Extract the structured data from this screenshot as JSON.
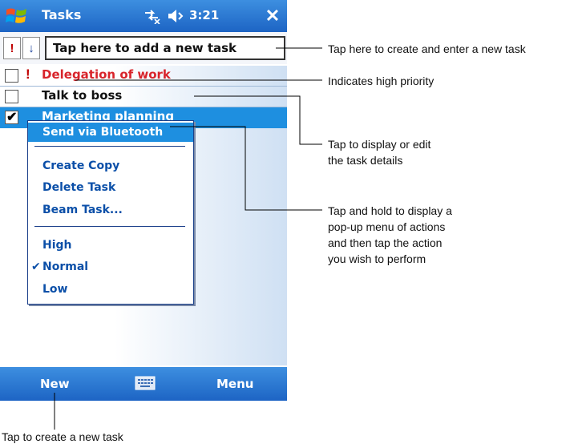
{
  "titlebar": {
    "app_title": "Tasks",
    "clock": "3:21",
    "close_label": "✕"
  },
  "entrybar": {
    "priority_label": "!",
    "sort_label": "↓",
    "new_task_placeholder": "Tap here to add a new task"
  },
  "tasks": [
    {
      "label": "Delegation of work",
      "priority": "high",
      "checked": false
    },
    {
      "label": "Talk to boss",
      "priority": "normal",
      "checked": false
    },
    {
      "label": "Marketing planning",
      "priority": "normal",
      "checked": true
    }
  ],
  "high_priority_marker": "!",
  "popup_menu": {
    "send_via_bluetooth": "Send via Bluetooth",
    "create_copy": "Create Copy",
    "delete_task": "Delete Task",
    "beam_task": "Beam Task...",
    "high": "High",
    "normal": "Normal",
    "low": "Low",
    "checkmark": "✔"
  },
  "bottombar": {
    "new_label": "New",
    "menu_label": "Menu"
  },
  "annotations": {
    "create_enter": "Tap here to create and enter a new task",
    "high_priority": "Indicates high priority",
    "details_line1": "Tap to display or edit",
    "details_line2": "the task details",
    "popup_line1": "Tap and hold to display a",
    "popup_line2": "pop-up menu of actions",
    "popup_line3": "and then tap the action",
    "popup_line4": "you wish to perform",
    "new_task": "Tap to create a new task"
  },
  "colors": {
    "titlebar": "#1d64c4",
    "highlight": "#1e8fe0",
    "priority_red": "#d8242b",
    "menu_text": "#0b4fa8"
  }
}
